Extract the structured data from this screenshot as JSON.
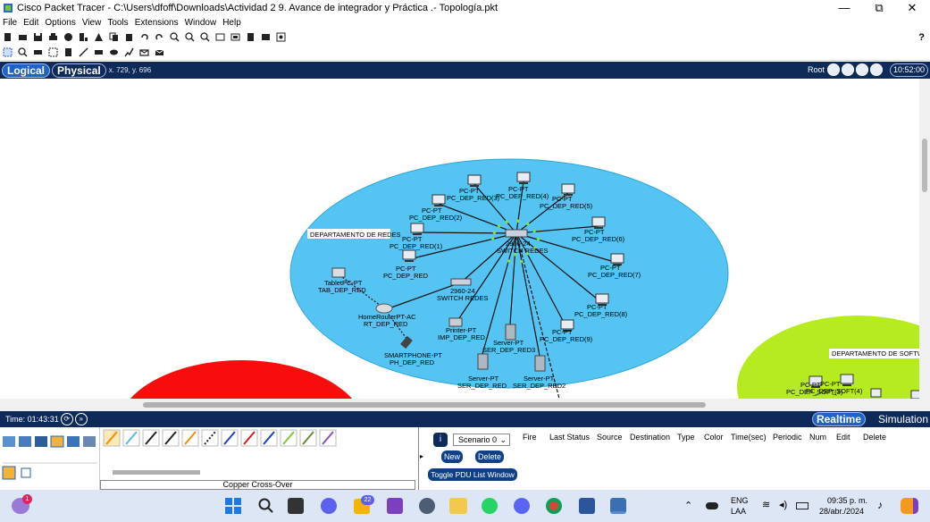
{
  "window": {
    "title": "Cisco Packet Tracer - C:\\Users\\dfoff\\Downloads\\Actividad 2 9. Avance de integrador y Práctica .- Topología.pkt",
    "minimize": "—",
    "restore": "⧉",
    "close": "✕"
  },
  "menu": [
    "File",
    "Edit",
    "Options",
    "View",
    "Tools",
    "Extensions",
    "Window",
    "Help"
  ],
  "help_glyph": "?",
  "mode": {
    "logical": "Logical",
    "physical": "Physical",
    "coords": "x. 729, y. 696",
    "root": "Root",
    "clock": "10:52:00"
  },
  "topology": {
    "area_label": "DEPARTAMENTO DE REDES",
    "area2_label": "DEPARTAMENTO DE SOFTWAR",
    "switch_main": {
      "model": "2960-24",
      "name": "SWITCH REDES"
    },
    "switch2": {
      "model": "2960-24",
      "name": "SWITCH REDES"
    },
    "router": {
      "model": "HomeRouterPT-AC",
      "name": "RT_DEP_RED"
    },
    "tablet": {
      "model": "TabletPC-PT",
      "name": "TAB_DEP_RED"
    },
    "smartphone": {
      "model": "SMARTPHONE-PT",
      "name": "PH_DEP_RED"
    },
    "printer": {
      "model": "Printer-PT",
      "name": "IMP_DEP_RED"
    },
    "servers": [
      {
        "model": "Server-PT",
        "name": "SER_DEP_RED3"
      },
      {
        "model": "Server-PT",
        "name": "SER_DEP_RED"
      },
      {
        "model": "Server-PT",
        "name": "SER_DEP_RED2"
      }
    ],
    "pcs": [
      {
        "model": "PC-PT",
        "name": "PC_DEP_RED"
      },
      {
        "model": "PC-PT",
        "name": "PC_DEP_RED(1)"
      },
      {
        "model": "PC-PT",
        "name": "PC_DEP_RED(2)"
      },
      {
        "model": "PC-PT",
        "name": "PC_DEP_RED(3)"
      },
      {
        "model": "PC-PT",
        "name": "PC_DEP_RED(4)"
      },
      {
        "model": "PC-PT",
        "name": "PC_DEP_RED(5)"
      },
      {
        "model": "PC-PT",
        "name": "PC_DEP_RED(6)"
      },
      {
        "model": "PC-PT",
        "name": "PC_DEP_RED(7)"
      },
      {
        "model": "PC-PT",
        "name": "PC_DEP_RED(8)"
      },
      {
        "model": "PC-PT",
        "name": "PC_DEP_RED(9)"
      }
    ],
    "soft_pcs": [
      {
        "model": "PC-PT",
        "name": "PC_DEP_SOFT(3)"
      },
      {
        "model": "PC-PT",
        "name": "PC_DEP_SOFT(4)"
      }
    ]
  },
  "timebar": {
    "time": "Time: 01:43:31",
    "realtime": "Realtime",
    "simulation": "Simulation"
  },
  "bottom": {
    "cable_label": "Copper Cross-Over",
    "scenario": "Scenario 0",
    "new_btn": "New",
    "delete_btn": "Delete",
    "toggle_btn": "Toggle PDU List Window",
    "pdu_headers": [
      "Fire",
      "Last Status",
      "Source",
      "Destination",
      "Type",
      "Color",
      "Time(sec)",
      "Periodic",
      "Num",
      "Edit",
      "Delete"
    ]
  },
  "taskbar": {
    "badge1": "1",
    "badge2": "22",
    "lang1": "ENG",
    "lang2": "LAA",
    "time": "09:35 p. m.",
    "date": "28/abr./2024"
  },
  "colors": {
    "navy": "#0d2a58",
    "network_blue": "#55c4f2",
    "software_green": "#b6ec1f",
    "red_area": "#f70d0d"
  }
}
